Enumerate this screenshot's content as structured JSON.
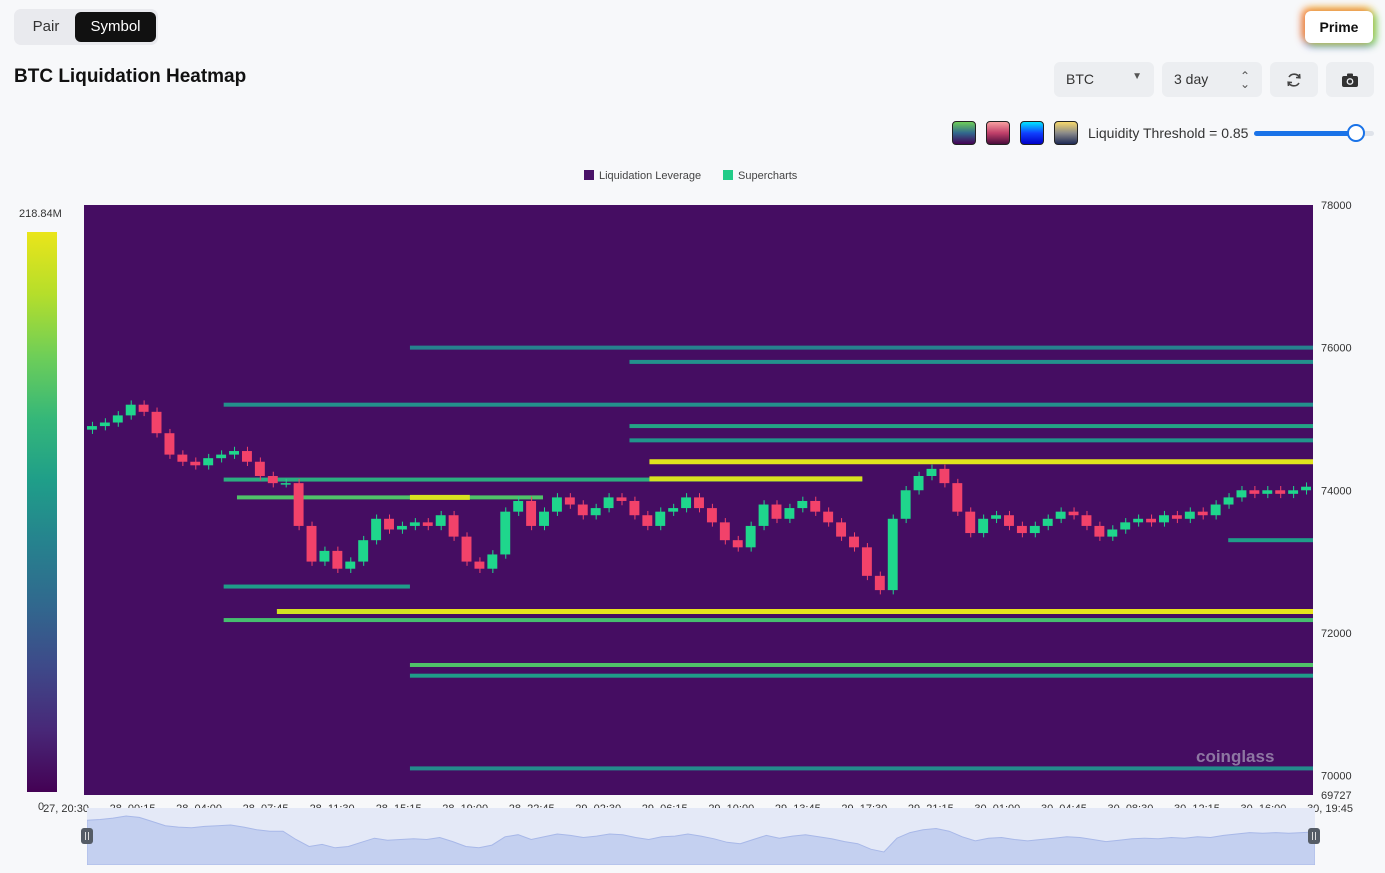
{
  "toggle": {
    "pair_label": "Pair",
    "symbol_label": "Symbol",
    "selected": "Symbol"
  },
  "prime_label": "Prime",
  "title": "BTC Liquidation Heatmap",
  "controls": {
    "symbol": "BTC",
    "period": "3 day",
    "refresh_icon": "refresh-icon",
    "camera_icon": "camera-icon"
  },
  "color_schemes": [
    {
      "name": "viridis",
      "colors": [
        "#35b779",
        "#440154"
      ]
    },
    {
      "name": "rose",
      "colors": [
        "#f8a0a0",
        "#4a0c3c"
      ]
    },
    {
      "name": "blue",
      "colors": [
        "#00e5ff",
        "#0000c8"
      ]
    },
    {
      "name": "gold",
      "colors": [
        "#f6d86b",
        "#1e2a55"
      ]
    }
  ],
  "threshold": {
    "label": "Liquidity Threshold = 0.85",
    "value": 0.85
  },
  "legend": [
    {
      "label": "Liquidation Leverage",
      "color": "#4a1268"
    },
    {
      "label": "Supercharts",
      "color": "#22cc88"
    }
  ],
  "colorbar": {
    "max_label": "218.84M",
    "min_label": "0"
  },
  "watermark": "coinglass",
  "chart_data": {
    "type": "heatmap",
    "title": "BTC Liquidation Heatmap",
    "y_ticks": [
      78000,
      76000,
      74000,
      72000,
      70000,
      69727
    ],
    "ylim": [
      69727,
      78000
    ],
    "x_ticks": [
      "27, 20:30",
      "28, 00:15",
      "28, 04:00",
      "28, 07:45",
      "28, 11:30",
      "28, 15:15",
      "28, 19:00",
      "28, 22:45",
      "29, 02:30",
      "29, 06:15",
      "29, 10:00",
      "29, 13:45",
      "29, 17:30",
      "29, 21:15",
      "30, 01:00",
      "30, 04:45",
      "30, 08:30",
      "30, 12:15",
      "30, 16:00",
      "30, 19:45"
    ],
    "x_index_range": [
      0,
      19
    ],
    "colorbar_range": [
      0,
      218840000
    ],
    "heat_bands": [
      {
        "price": 74400,
        "start": 8.8,
        "end": 19,
        "intensity": 0.98
      },
      {
        "price": 74150,
        "start": 2.4,
        "end": 12,
        "intensity": 0.62
      },
      {
        "price": 74160,
        "start": 8.8,
        "end": 12,
        "intensity": 0.96
      },
      {
        "price": 73900,
        "start": 2.6,
        "end": 7.2,
        "intensity": 0.72
      },
      {
        "price": 73900,
        "start": 5.2,
        "end": 6.1,
        "intensity": 0.96
      },
      {
        "price": 72300,
        "start": 3.2,
        "end": 19,
        "intensity": 0.95
      },
      {
        "price": 72300,
        "start": 5.2,
        "end": 19,
        "intensity": 0.99
      },
      {
        "price": 72180,
        "start": 2.4,
        "end": 19,
        "intensity": 0.7
      },
      {
        "price": 71550,
        "start": 5.2,
        "end": 19,
        "intensity": 0.72
      },
      {
        "price": 71400,
        "start": 5.2,
        "end": 19,
        "intensity": 0.55
      },
      {
        "price": 75200,
        "start": 2.4,
        "end": 19,
        "intensity": 0.5
      },
      {
        "price": 74900,
        "start": 8.5,
        "end": 19,
        "intensity": 0.58
      },
      {
        "price": 74700,
        "start": 8.5,
        "end": 19,
        "intensity": 0.52
      },
      {
        "price": 76000,
        "start": 5.2,
        "end": 19,
        "intensity": 0.44
      },
      {
        "price": 75800,
        "start": 8.5,
        "end": 19,
        "intensity": 0.5
      },
      {
        "price": 70100,
        "start": 5.2,
        "end": 19,
        "intensity": 0.48
      },
      {
        "price": 72650,
        "start": 2.4,
        "end": 5.2,
        "intensity": 0.55
      },
      {
        "price": 73300,
        "start": 17.5,
        "end": 19,
        "intensity": 0.55
      }
    ],
    "candles_close": [
      74900,
      74950,
      75050,
      75200,
      75100,
      74800,
      74500,
      74400,
      74350,
      74450,
      74500,
      74550,
      74400,
      74200,
      74100,
      74100,
      73500,
      73000,
      73150,
      72900,
      73000,
      73300,
      73600,
      73450,
      73500,
      73550,
      73500,
      73650,
      73350,
      73000,
      72900,
      73100,
      73700,
      73850,
      73500,
      73700,
      73900,
      73800,
      73650,
      73750,
      73900,
      73850,
      73650,
      73500,
      73700,
      73750,
      73900,
      73750,
      73550,
      73300,
      73200,
      73500,
      73800,
      73600,
      73750,
      73850,
      73700,
      73550,
      73350,
      73200,
      72800,
      72600,
      73600,
      74000,
      74200,
      74300,
      74100,
      73700,
      73400,
      73600,
      73650,
      73500,
      73400,
      73500,
      73600,
      73700,
      73650,
      73500,
      73350,
      73450,
      73550,
      73600,
      73550,
      73650,
      73600,
      73700,
      73650,
      73800,
      73900,
      74000,
      73950,
      74000,
      73950,
      74000,
      74050
    ]
  }
}
